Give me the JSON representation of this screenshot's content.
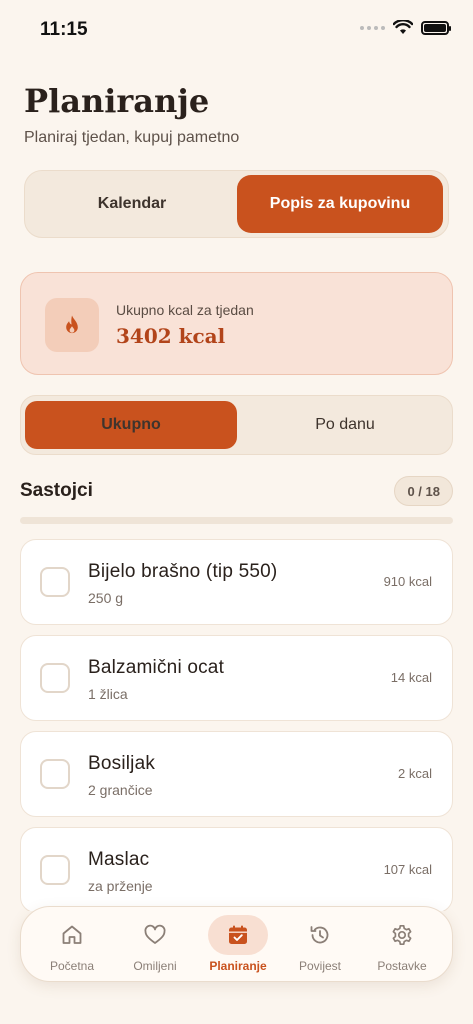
{
  "status_bar": {
    "time": "11:15"
  },
  "header": {
    "title": "Planiranje",
    "subtitle": "Planiraj tjedan, kupuj pametno"
  },
  "view_toggle": {
    "options": [
      "Kalendar",
      "Popis za kupovinu"
    ],
    "selected": "Popis za kupovinu"
  },
  "kcal_summary": {
    "label": "Ukupno kcal za tjedan",
    "value": "3402 kcal",
    "icon": "flame-icon"
  },
  "mode_toggle": {
    "options": [
      "Ukupno",
      "Po danu"
    ],
    "selected": "Ukupno"
  },
  "ingredients": {
    "title": "Sastojci",
    "count": "0 / 18",
    "progress_fraction": 0,
    "items": [
      {
        "name": "Bijelo brašno (tip 550)",
        "quantity": "250 g",
        "kcal": "910 kcal",
        "checked": false
      },
      {
        "name": "Balzamični ocat",
        "quantity": "1 žlica",
        "kcal": "14 kcal",
        "checked": false
      },
      {
        "name": "Bosiljak",
        "quantity": "2 grančice",
        "kcal": "2 kcal",
        "checked": false
      },
      {
        "name": "Maslac",
        "quantity": "za prženje",
        "kcal": "107 kcal",
        "checked": false
      }
    ]
  },
  "bottom_nav": {
    "items": [
      {
        "label": "Početna",
        "icon": "home-icon"
      },
      {
        "label": "Omiljeni",
        "icon": "heart-icon"
      },
      {
        "label": "Planiranje",
        "icon": "calendar-check-icon"
      },
      {
        "label": "Povijest",
        "icon": "history-icon"
      },
      {
        "label": "Postavke",
        "icon": "gear-icon"
      }
    ],
    "active": "Planiranje"
  },
  "colors": {
    "accent": "#c9521e",
    "background": "#fbf5ee",
    "kcal_card": "#f9e2d7"
  }
}
